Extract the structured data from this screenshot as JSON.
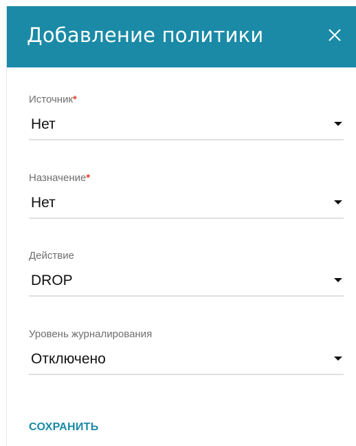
{
  "dialog": {
    "title": "Добавление политики",
    "close_icon": "close-icon"
  },
  "colors": {
    "header_bg": "#1a8aa6",
    "accent": "#1a8aa6",
    "required_mark": "#e0442a"
  },
  "fields": [
    {
      "label": "Источник",
      "required_mark": "*",
      "value": "Нет",
      "icon": "chevron-down-icon"
    },
    {
      "label": "Назначение",
      "required_mark": "*",
      "value": "Нет",
      "icon": "chevron-down-icon"
    },
    {
      "label": "Действие",
      "required_mark": "",
      "value": "DROP",
      "icon": "chevron-down-icon"
    },
    {
      "label": "Уровень журналирования",
      "required_mark": "",
      "value": "Отключено",
      "icon": "chevron-down-icon"
    }
  ],
  "actions": {
    "save_label": "СОХРАНИТЬ"
  }
}
